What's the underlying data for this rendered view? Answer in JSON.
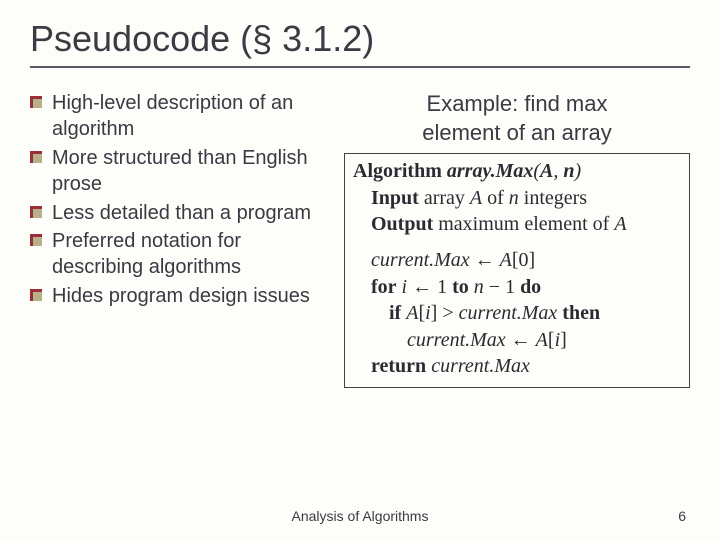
{
  "title": "Pseudocode (§ 3.1.2)",
  "bullets": [
    "High-level description of an algorithm",
    "More structured than English prose",
    "Less detailed than a program",
    "Preferred notation for describing algorithms",
    "Hides program design issues"
  ],
  "example_caption_l1": "Example: find max",
  "example_caption_l2": "element of an array",
  "algo": {
    "header_kw": "Algorithm",
    "header_name": "array.Max",
    "header_args_open": "(",
    "header_arg1": "A",
    "header_comma": ", ",
    "header_arg2": "n",
    "header_args_close": ")",
    "input_kw": "Input",
    "input_t1": " array ",
    "input_A": "A",
    "input_t2": " of ",
    "input_n": "n",
    "input_t3": " integers",
    "output_kw": "Output",
    "output_t1": " maximum element of ",
    "output_A": "A",
    "cm": "current.Max",
    "assign": " ← ",
    "a0": "A",
    "br0o": "[0]",
    "for_kw": "for",
    "sp": " ",
    "i": "i",
    "one": "1",
    "to_kw": "to",
    "n": "n",
    "minus": " − ",
    "do_kw": "do",
    "if_kw": "if",
    "Ai_A": "A",
    "Ai_open": "[",
    "Ai_i": "i",
    "Ai_close": "]",
    "gt": " > ",
    "then_kw": "then",
    "return_kw": "return"
  },
  "footer": "Analysis of Algorithms",
  "page": "6"
}
